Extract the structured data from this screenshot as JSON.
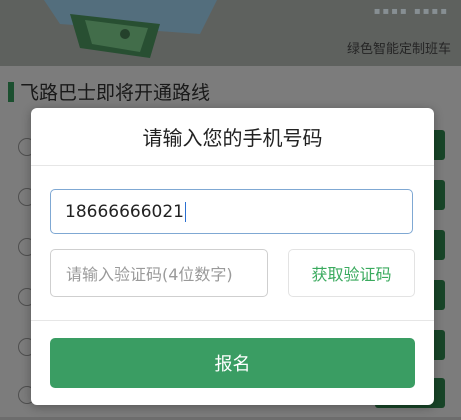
{
  "background": {
    "banner_caption": "绿色智能定制班车",
    "section_title": "飞路巴士即将开通路线",
    "row_count": 6
  },
  "modal": {
    "title": "请输入您的手机号码",
    "phone_value": "18666666021",
    "code_placeholder": "请输入验证码(4位数字)",
    "get_code_label": "获取验证码",
    "submit_label": "报名"
  },
  "colors": {
    "accent_green": "#3a9d63",
    "link_green": "#3aaa5e",
    "focus_blue": "#7fa8d3"
  }
}
